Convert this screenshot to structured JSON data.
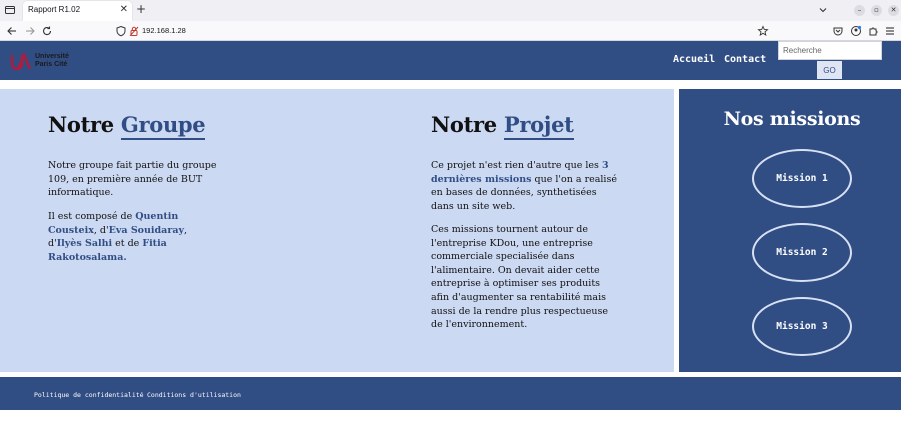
{
  "browser": {
    "tab_title": "Rapport R1.02",
    "url": "192.168.1.28"
  },
  "header": {
    "logo_line1": "Université",
    "logo_line2": "Paris Cité",
    "nav": [
      "Accueil",
      "Contact"
    ],
    "search_placeholder": "Recherche",
    "go_label": "GO"
  },
  "groupe": {
    "heading_plain": "Notre",
    "heading_accent": "Groupe",
    "p1": "Notre groupe fait partie du groupe 109, en première année de BUT informatique.",
    "p2_prefix": "Il est composé de ",
    "member1": "Quentin Cousteix",
    "p2_sep1": ", d'",
    "member2": "Eva Souidaray",
    "p2_sep2": ", d'",
    "member3": "Ilyès Salhi",
    "p2_sep3": " et de ",
    "member4": "Fitia Rakotosalama",
    "p2_end": "."
  },
  "projet": {
    "heading_plain": "Notre",
    "heading_accent": "Projet",
    "p1_prefix": "Ce projet n'est rien d'autre que les ",
    "p1_link": "3 dernières missions",
    "p1_suffix": " que l'on a realisé en bases de données, synthetisées dans un site web.",
    "p2": "Ces missions tournent autour de l'entreprise KDou, une entreprise commerciale specialisée dans l'alimentaire. On devait aider cette entreprise à optimiser ses produits afin d'augmenter sa rentabilité mais aussi de la rendre plus respectueuse de l'environnement."
  },
  "missions": {
    "title": "Nos missions",
    "items": [
      "Mission 1",
      "Mission 2",
      "Mission 3"
    ]
  },
  "footer": {
    "links": [
      "Politique de confidentialité",
      "Conditions d'utilisation"
    ]
  },
  "colors": {
    "brand_blue": "#314e84",
    "content_bg": "#ccd9f3",
    "logo_red": "#b01c3c"
  }
}
